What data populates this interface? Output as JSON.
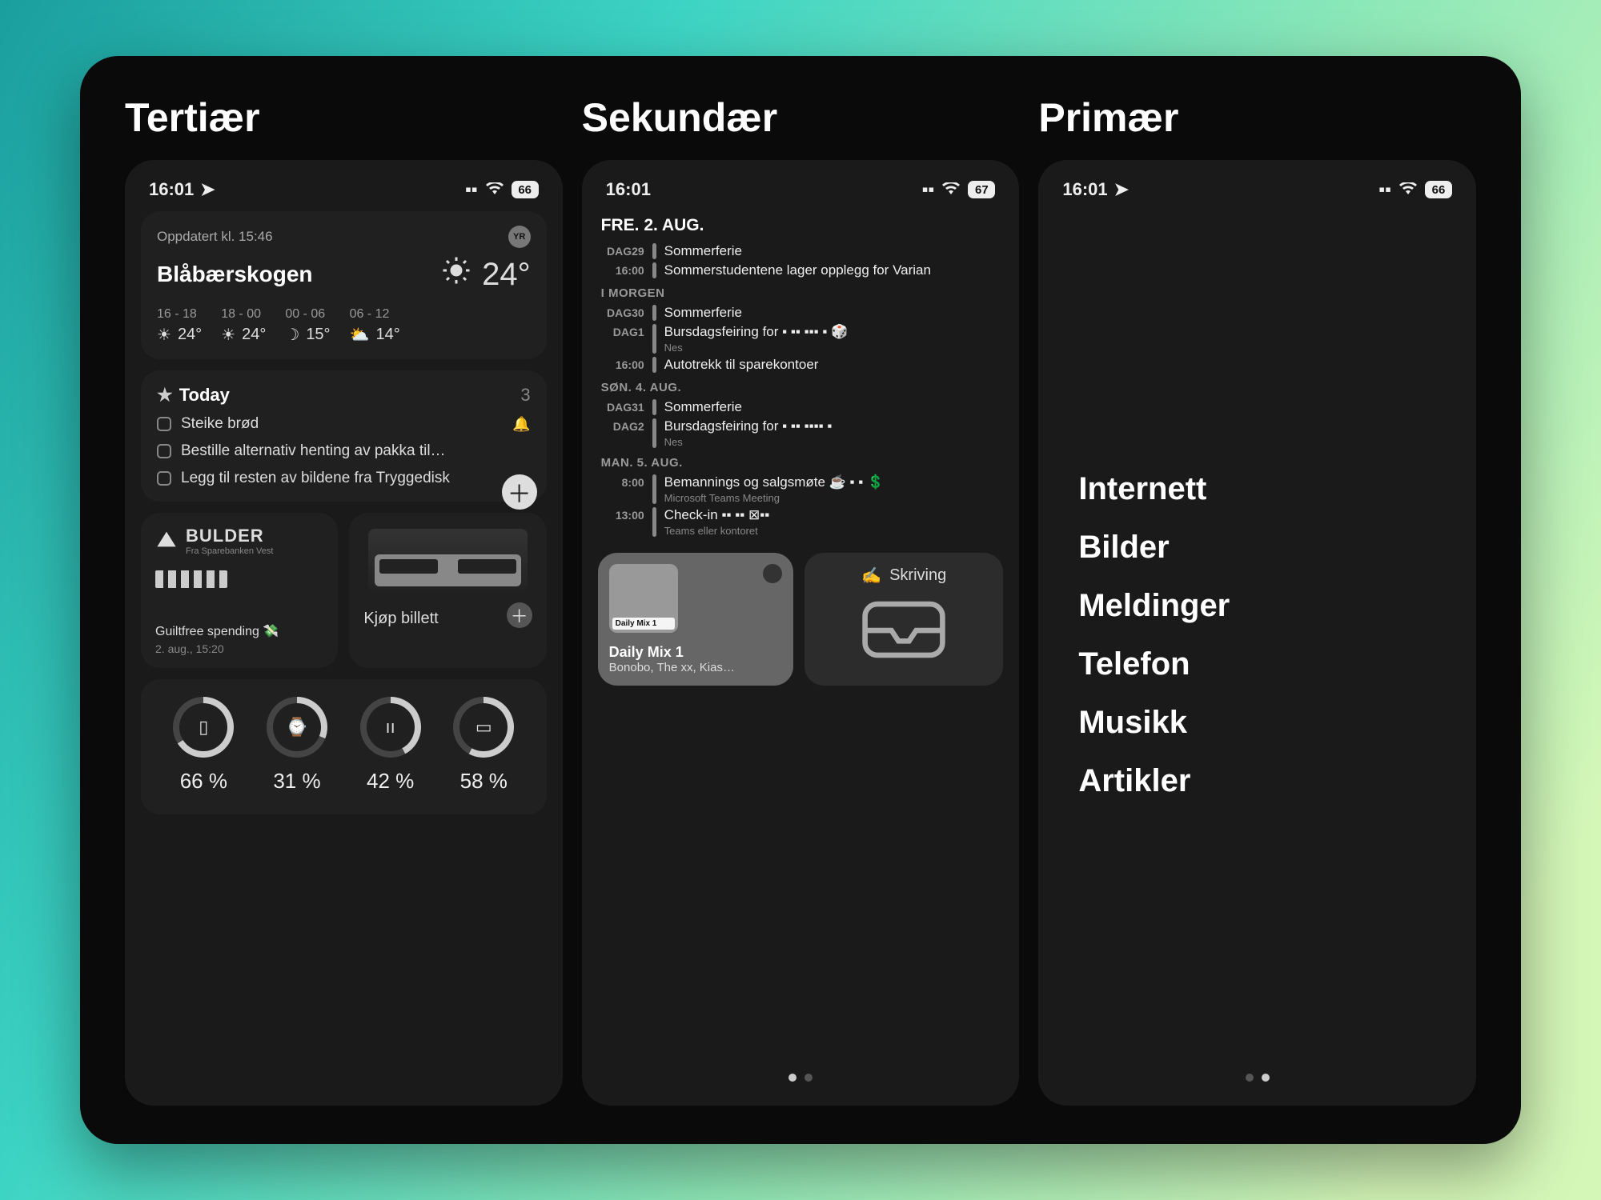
{
  "columns": {
    "tertiary_title": "Tertiær",
    "secondary_title": "Sekundær",
    "primary_title": "Primær"
  },
  "tertiary": {
    "status": {
      "time": "16:01",
      "battery": "66"
    },
    "weather": {
      "updated": "Oppdatert kl. 15:46",
      "provider": "YR",
      "location": "Blåbærskogen",
      "now_temp": "24°",
      "forecast": [
        {
          "range": "16 - 18",
          "temp": "24°",
          "icon": "sun"
        },
        {
          "range": "18 - 00",
          "temp": "24°",
          "icon": "sun"
        },
        {
          "range": "00 - 06",
          "temp": "15°",
          "icon": "moon"
        },
        {
          "range": "06 - 12",
          "temp": "14°",
          "icon": "cloud"
        }
      ]
    },
    "todo": {
      "title": "Today",
      "count": "3",
      "items": [
        {
          "label": "Steike brød",
          "bell": true
        },
        {
          "label": "Bestille alternativ henting av pakka til…",
          "bell": false
        },
        {
          "label": "Legg til resten av bildene fra Tryggedisk",
          "bell": false
        }
      ]
    },
    "bulder": {
      "brand": "BULDER",
      "sub": "Fra Sparebanken Vest",
      "label": "Guiltfree spending 💸",
      "date": "2. aug., 15:20"
    },
    "transit": {
      "buy": "Kjøp billett"
    },
    "batteries": [
      {
        "icon": "phone",
        "pct": "66 %",
        "p": 66
      },
      {
        "icon": "watch",
        "pct": "31 %",
        "p": 31
      },
      {
        "icon": "earbuds",
        "pct": "42 %",
        "p": 42
      },
      {
        "icon": "case",
        "pct": "58 %",
        "p": 58
      }
    ]
  },
  "secondary": {
    "status": {
      "time": "16:01",
      "battery": "67"
    },
    "calendar": {
      "header": "FRE. 2. AUG.",
      "rows_a": [
        {
          "time": "DAG29",
          "text": "Sommerferie"
        },
        {
          "time": "16:00",
          "text": "Sommerstudentene lager opplegg for Varian"
        }
      ],
      "sub_b": "I MORGEN",
      "rows_b": [
        {
          "time": "DAG30",
          "text": "Sommerferie"
        },
        {
          "time": "DAG1",
          "text": "Bursdagsfeiring for ▪ ▪▪ ▪▪▪ ▪ 🎲",
          "sub": "Nes"
        },
        {
          "time": "16:00",
          "text": "Autotrekk til sparekontoer"
        }
      ],
      "sub_c": "SØN. 4. AUG.",
      "rows_c": [
        {
          "time": "DAG31",
          "text": "Sommerferie"
        },
        {
          "time": "DAG2",
          "text": "Bursdagsfeiring for ▪ ▪▪ ▪▪▪▪ ▪",
          "sub": "Nes"
        }
      ],
      "sub_d": "MAN. 5. AUG.",
      "rows_d": [
        {
          "time": "8:00",
          "text": "Bemannings og salgsmøte ☕ ▪ ▪ 💲",
          "sub": "Microsoft Teams Meeting"
        },
        {
          "time": "13:00",
          "text": "Check-in ▪▪ ▪▪ ⊠▪▪",
          "sub": "Teams eller kontoret"
        }
      ]
    },
    "spotify": {
      "art_label": "Daily Mix 1",
      "title": "Daily Mix 1",
      "subtitle": "Bonobo, The xx, Kias…"
    },
    "skriving": {
      "label": "Skriving"
    }
  },
  "primary": {
    "status": {
      "time": "16:01",
      "battery": "66"
    },
    "apps": [
      "Internett",
      "Bilder",
      "Meldinger",
      "Telefon",
      "Musikk",
      "Artikler"
    ]
  }
}
